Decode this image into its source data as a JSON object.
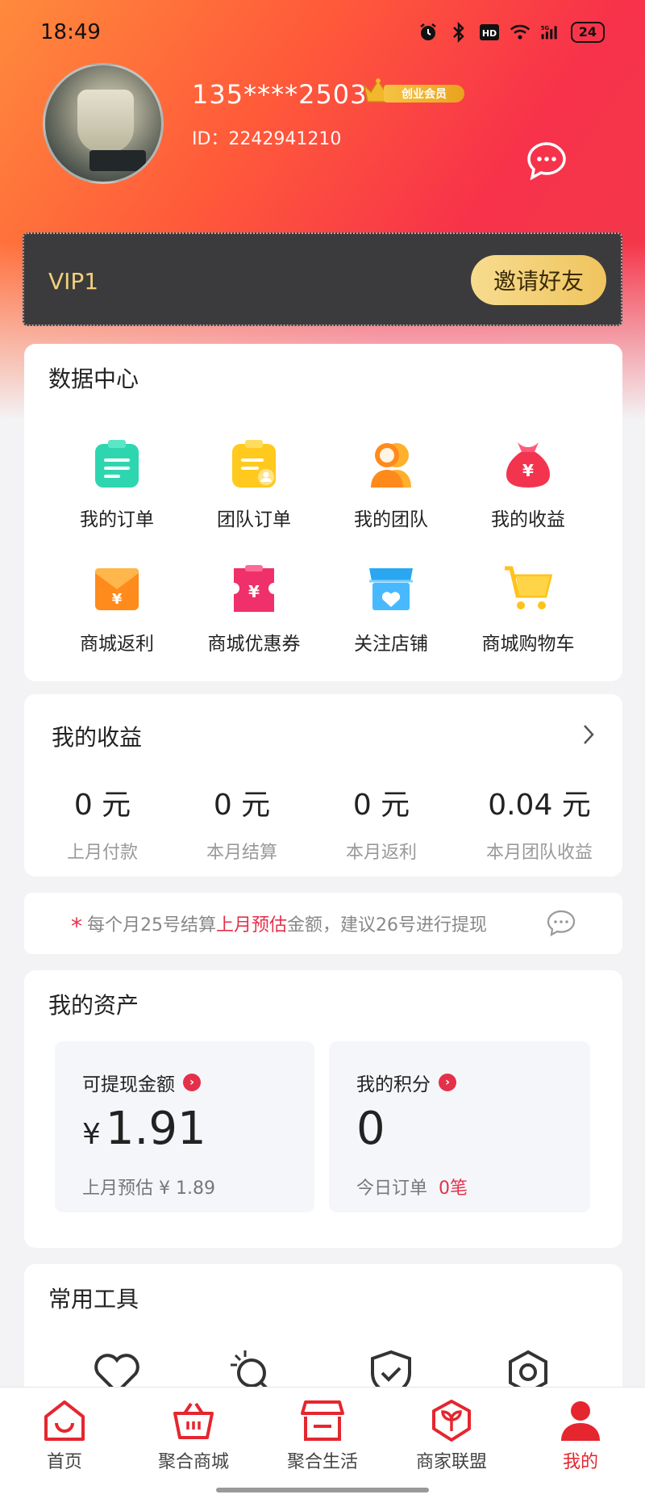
{
  "status_bar": {
    "time": "18:49",
    "network": "5G",
    "hd_label": "HD",
    "battery": "24"
  },
  "profile": {
    "username": "135****2503",
    "member_badge": "创业会员",
    "id_text": "ID：2242941210"
  },
  "vip": {
    "level": "VIP1",
    "invite_label": "邀请好友"
  },
  "data_center": {
    "title": "数据中心",
    "items": [
      {
        "label": "我的订单",
        "icon": "order-icon"
      },
      {
        "label": "团队订单",
        "icon": "team-order-icon"
      },
      {
        "label": "我的团队",
        "icon": "team-icon"
      },
      {
        "label": "我的收益",
        "icon": "money-bag-icon"
      },
      {
        "label": "商城返利",
        "icon": "rebate-envelope-icon"
      },
      {
        "label": "商城优惠券",
        "icon": "coupon-icon"
      },
      {
        "label": "关注店铺",
        "icon": "store-follow-icon"
      },
      {
        "label": "商城购物车",
        "icon": "cart-icon"
      }
    ]
  },
  "earnings": {
    "title": "我的收益",
    "items": [
      {
        "value": "0 元",
        "label": "上月付款"
      },
      {
        "value": "0 元",
        "label": "本月结算"
      },
      {
        "value": "0 元",
        "label": "本月返利"
      },
      {
        "value": "0.04 元",
        "label": "本月团队收益"
      }
    ]
  },
  "notice": {
    "star": "*",
    "text_before": "每个月25号结算",
    "highlight": "上月预估",
    "text_after": "金额，建议26号进行提现"
  },
  "assets": {
    "title": "我的资产",
    "withdrawable": {
      "label": "可提现金额",
      "currency": "¥",
      "value": "1.91",
      "sub_label": "上月预估 ¥ 1.89"
    },
    "points": {
      "label": "我的积分",
      "value": "0",
      "sub_label": "今日订单",
      "sub_value": "0笔"
    }
  },
  "tools": {
    "title": "常用工具",
    "icons": [
      "heart-icon",
      "search-person-icon",
      "shield-check-icon",
      "camera-settings-icon"
    ]
  },
  "tabbar": {
    "items": [
      {
        "label": "首页",
        "icon": "home-icon",
        "active": false
      },
      {
        "label": "聚合商城",
        "icon": "basket-icon",
        "active": false
      },
      {
        "label": "聚合生活",
        "icon": "shop-icon",
        "active": false
      },
      {
        "label": "商家联盟",
        "icon": "leaf-shield-icon",
        "active": false
      },
      {
        "label": "我的",
        "icon": "user-icon",
        "active": true
      }
    ]
  },
  "colors": {
    "accent": "#e5262f",
    "gold": "#f2cf7a",
    "gradient_start": "#ff8a3c",
    "gradient_end": "#f23a4a"
  }
}
